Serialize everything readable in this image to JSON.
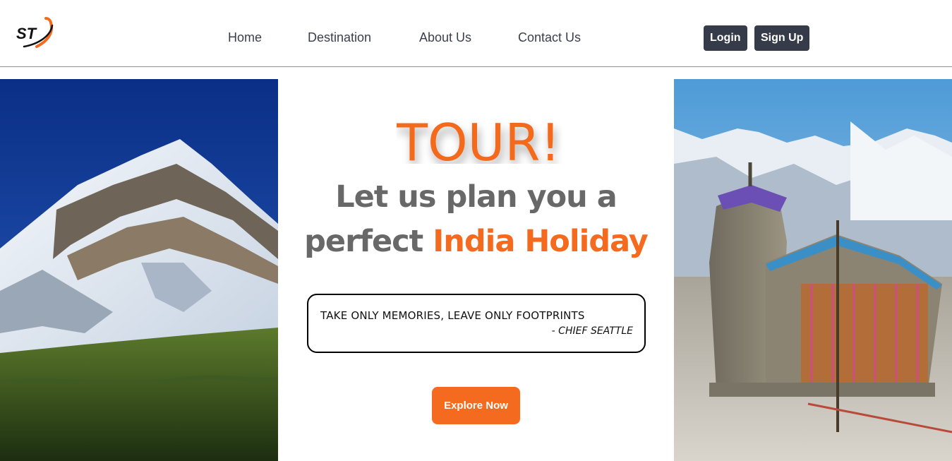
{
  "brand": {
    "logo_text": "ST",
    "logo_icon": "swoosh-logo-icon"
  },
  "nav": {
    "links": [
      "Home",
      "Destination",
      "About Us",
      "Contact Us"
    ],
    "login_label": "Login",
    "signup_label": "Sign Up"
  },
  "hero": {
    "tour_word": "TOUR!",
    "headline_line1": "Let us plan you a",
    "headline_prefix": "perfect ",
    "headline_accent": "India Holiday",
    "quote": "TAKE ONLY MEMORIES, LEAVE ONLY FOOTPRINTS",
    "quote_author": "- CHIEF SEATTLE",
    "cta_label": "Explore Now"
  },
  "images": {
    "left": "snow-mountain-photo",
    "right": "mountain-temple-photo"
  },
  "colors": {
    "accent": "#f46a1e",
    "nav_button": "#353b48",
    "headline_gray": "#686868",
    "nav_text": "#3a3f4d"
  }
}
